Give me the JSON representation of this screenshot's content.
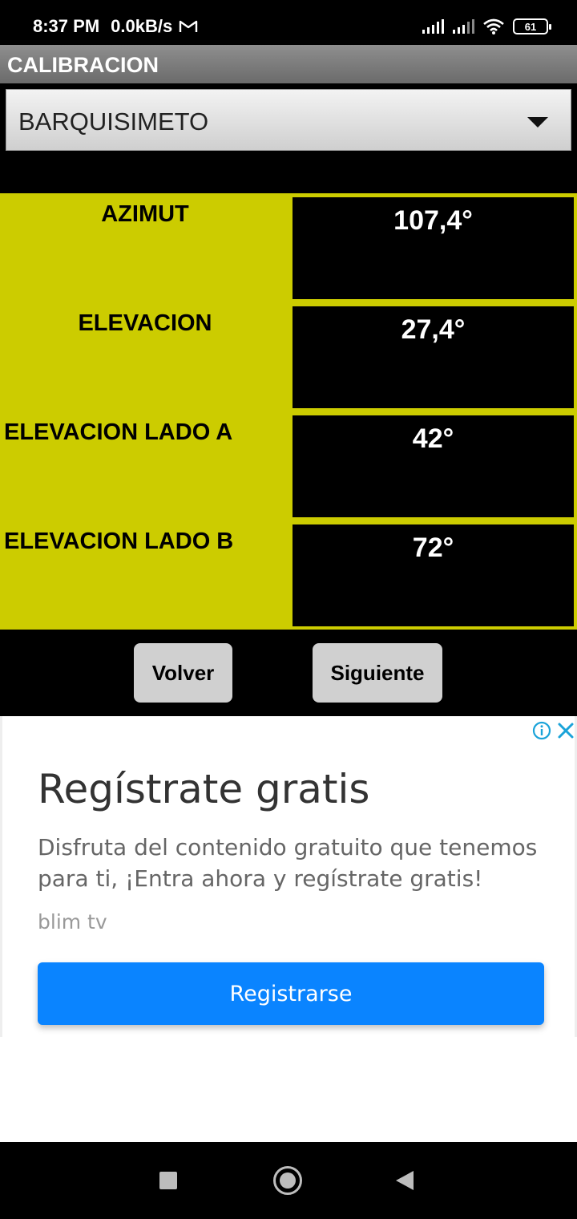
{
  "status_bar": {
    "time": "8:37 PM",
    "network_speed": "0.0kB/s",
    "battery_level": "61"
  },
  "app": {
    "title": "CALIBRACION"
  },
  "location_select": {
    "selected": "BARQUISIMETO"
  },
  "table": {
    "rows": [
      {
        "label": "AZIMUT",
        "value": "107,4°"
      },
      {
        "label": "ELEVACION",
        "value": "27,4°"
      },
      {
        "label": "ELEVACION LADO A",
        "value": "42°"
      },
      {
        "label": "ELEVACION LADO B",
        "value": "72°"
      }
    ]
  },
  "buttons": {
    "back": "Volver",
    "next": "Siguiente"
  },
  "ad": {
    "title": "Regístrate gratis",
    "body": "Disfruta del contenido gratuito que tenemos para ti, ¡Entra ahora y regístrate gratis!",
    "advertiser": "blim tv",
    "cta": "Registrarse"
  },
  "colors": {
    "table_bg": "#cccc00",
    "cta_bg": "#0a84ff",
    "ad_icon": "#1aa3d9"
  }
}
